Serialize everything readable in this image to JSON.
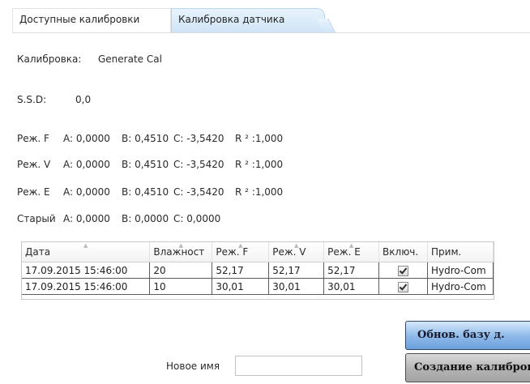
{
  "tabs": [
    {
      "label": "Доступные калибровки",
      "active": true
    },
    {
      "label": "Калибровка датчика",
      "active": false
    }
  ],
  "calibration": {
    "label": "Калибровка:",
    "value": "Generate Cal"
  },
  "ssd": {
    "label": "S.S.D:",
    "value": "0,0"
  },
  "modes": [
    {
      "name": "Реж. F",
      "a": "A: 0,0000",
      "b": "B: 0,4510",
      "c": "C: -3,5420",
      "r2": "R ² :1,000"
    },
    {
      "name": "Реж. V",
      "a": "A: 0,0000",
      "b": "B: 0,4510",
      "c": "C: -3,5420",
      "r2": "R ² :1,000"
    },
    {
      "name": "Реж. E",
      "a": "A: 0,0000",
      "b": "B: 0,4510",
      "c": "C: -3,5420",
      "r2": "R ² :1,000"
    },
    {
      "name": "Старый",
      "a": "A: 0,0000",
      "b": "B: 0,0000",
      "c": "C: 0,0000",
      "r2": ""
    }
  ],
  "table": {
    "headers": [
      "Дата",
      "Влажност",
      "Реж. F",
      "Реж. V",
      "Реж. E",
      "Включ.",
      "Прим."
    ],
    "rows": [
      {
        "date": "17.09.2015 15:46:00",
        "moisture": "20",
        "f": "52,17",
        "v": "52,17",
        "e": "52,17",
        "enabled": true,
        "note": "Hydro-Com"
      },
      {
        "date": "17.09.2015 15:46:00",
        "moisture": "10",
        "f": "30,01",
        "v": "30,01",
        "e": "30,01",
        "enabled": true,
        "note": "Hydro-Com"
      }
    ]
  },
  "buttons": {
    "update_db": "Обнов. базу д.",
    "create_calibration": "Создание калибров"
  },
  "new_name": {
    "label": "Новое имя",
    "value": "",
    "placeholder": ""
  },
  "colors": {
    "tab_inactive": "#cfe4f6",
    "button_blue": "#8cb8e8",
    "button_gray": "#b3b3b3"
  }
}
